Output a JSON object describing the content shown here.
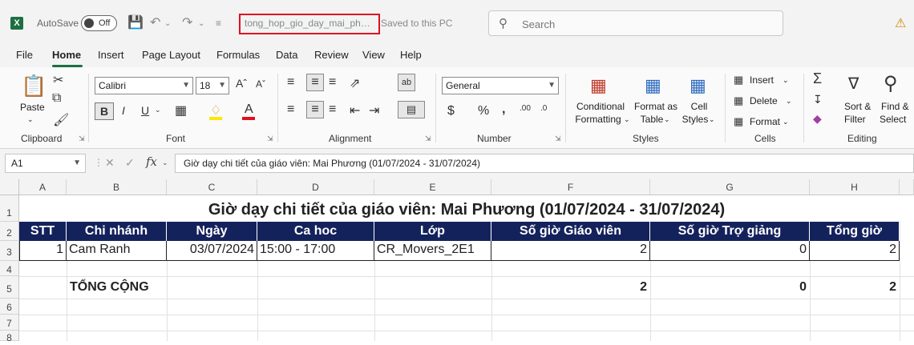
{
  "titlebar": {
    "app_logo": "X",
    "autosave_label": "AutoSave",
    "autosave_state": "Off",
    "filename": "tong_hop_gio_day_mai_phu...",
    "save_status": "Saved to this PC",
    "search_placeholder": "Search"
  },
  "menu": [
    "File",
    "Home",
    "Insert",
    "Page Layout",
    "Formulas",
    "Data",
    "Review",
    "View",
    "Help"
  ],
  "ribbon": {
    "clipboard": {
      "paste": "Paste",
      "label": "Clipboard"
    },
    "font": {
      "name": "Calibri",
      "size": "18",
      "label": "Font",
      "bold": "B",
      "italic": "I",
      "underline": "U"
    },
    "alignment": {
      "label": "Alignment"
    },
    "number": {
      "format": "General",
      "label": "Number",
      "currency": "$",
      "percent": "%"
    },
    "styles": {
      "conditional_1": "Conditional",
      "conditional_2": "Formatting",
      "format_table_1": "Format as",
      "format_table_2": "Table",
      "cell_styles_1": "Cell",
      "cell_styles_2": "Styles",
      "label": "Styles"
    },
    "cells": {
      "insert": "Insert",
      "delete": "Delete",
      "format": "Format",
      "label": "Cells"
    },
    "editing": {
      "sort_1": "Sort &",
      "sort_2": "Filter",
      "find_1": "Find &",
      "find_2": "Select",
      "label": "Editing"
    }
  },
  "formula_bar": {
    "name_box": "A1",
    "formula": "Giờ dạy chi tiết của giáo viên: Mai Phương (01/07/2024 - 31/07/2024)"
  },
  "sheet": {
    "columns": [
      "A",
      "B",
      "C",
      "D",
      "E",
      "F",
      "G",
      "H"
    ],
    "rows": [
      "1",
      "2",
      "3",
      "4",
      "5",
      "6",
      "7",
      "8"
    ],
    "title": "Giờ dạy chi tiết của giáo viên: Mai Phương (01/07/2024 - 31/07/2024)",
    "headers": [
      "STT",
      "Chi nhánh",
      "Ngày",
      "Ca hoc",
      "Lớp",
      "Số giờ Giáo viên",
      "Số giờ Trợ giảng",
      "Tổng giờ"
    ],
    "row3": [
      "1",
      "Cam Ranh",
      "03/07/2024",
      "15:00 - 17:00",
      "CR_Movers_2E1",
      "2",
      "0",
      "2"
    ],
    "total": {
      "label": "TỔNG CỘNG",
      "teacher": "2",
      "assistant": "0",
      "sum": "2"
    }
  },
  "colors": {
    "header_fill": "#14225c",
    "accent": "#1d6f42",
    "highlight": "#e0101e"
  }
}
